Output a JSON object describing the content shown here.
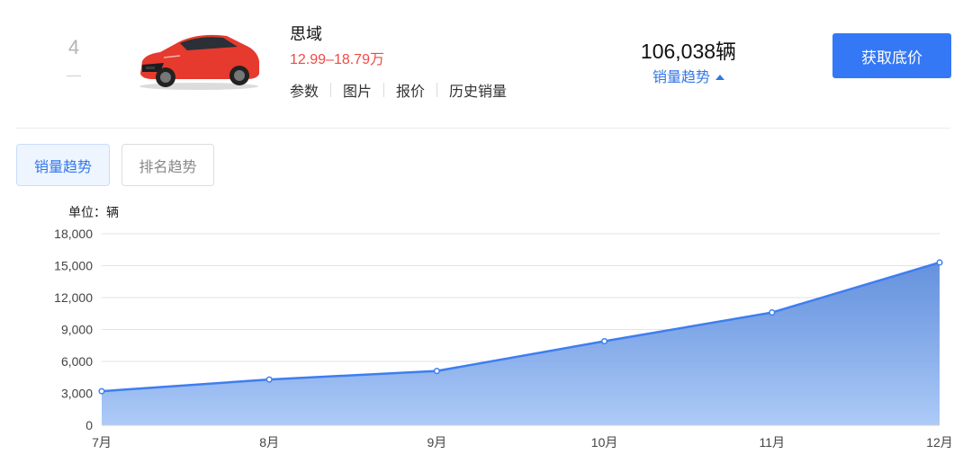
{
  "rank": {
    "number": "4",
    "change": "–"
  },
  "car": {
    "name": "思域",
    "price_range": "12.99–18.79万",
    "links": [
      "参数",
      "图片",
      "报价",
      "历史销量"
    ]
  },
  "sales": {
    "total": "106,038辆",
    "trend_toggle": "销量趋势"
  },
  "actions": {
    "get_price": "获取底价"
  },
  "tabs": [
    {
      "label": "销量趋势",
      "active": true
    },
    {
      "label": "排名趋势",
      "active": false
    }
  ],
  "colors": {
    "accent": "#3478f6",
    "price": "#f04a44",
    "line": "#3d7ef0"
  },
  "chart_data": {
    "type": "area",
    "unit_label": "单位：辆",
    "categories": [
      "7月",
      "8月",
      "9月",
      "10月",
      "11月",
      "12月"
    ],
    "values": [
      3200,
      4300,
      5100,
      7900,
      10600,
      15300
    ],
    "ylim": [
      0,
      18000
    ],
    "yticks": [
      "0",
      "3,000",
      "6,000",
      "9,000",
      "12,000",
      "15,000",
      "18,000"
    ],
    "ytick_values": [
      0,
      3000,
      6000,
      9000,
      12000,
      15000,
      18000
    ],
    "grid": true,
    "legend": "none"
  }
}
